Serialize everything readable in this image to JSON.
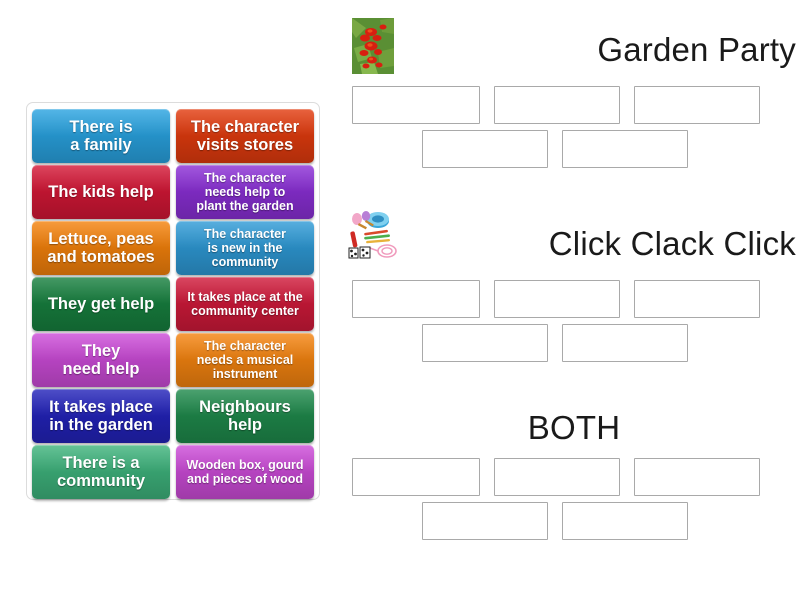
{
  "activity": {
    "type": "group-sort",
    "tile_panel": {
      "name": "draggable-items",
      "tiles": [
        {
          "text": "There is\na family",
          "color": "#29a3e0",
          "size": "big"
        },
        {
          "text": "The character\nvisits stores",
          "color": "#e23b0e",
          "size": "big"
        },
        {
          "text": "The kids help",
          "color": "#d41736",
          "size": "big"
        },
        {
          "text": "The character\nneeds help to\nplant the garden",
          "color": "#8b2fd6",
          "size": "small"
        },
        {
          "text": "Lettuce, peas\nand tomatoes",
          "color": "#f5820b",
          "size": "big"
        },
        {
          "text": "The character\nis new in the\ncommunity",
          "color": "#2e9ad6",
          "size": "small"
        },
        {
          "text": "They get help",
          "color": "#17803f",
          "size": "big"
        },
        {
          "text": "It takes place at the\ncommunity center",
          "color": "#d0193a",
          "size": "small"
        },
        {
          "text": "They\nneed help",
          "color": "#cc4bd8",
          "size": "big"
        },
        {
          "text": "The character\nneeds a musical\ninstrument",
          "color": "#f58410",
          "size": "small"
        },
        {
          "text": "It takes place\nin the garden",
          "color": "#2323ba",
          "size": "big"
        },
        {
          "text": "Neighbours\nhelp",
          "color": "#1f8a4c",
          "size": "big"
        },
        {
          "text": "There is a\ncommunity",
          "color": "#3eb37c",
          "size": "big"
        },
        {
          "text": "Wooden box, gourd\nand pieces of wood",
          "color": "#cc4bd8",
          "size": "small"
        }
      ]
    },
    "groups": [
      {
        "title": "Garden Party",
        "image": "garden-plant-photo",
        "has_image": true,
        "title_align": "right",
        "dropzones": [
          3,
          2
        ]
      },
      {
        "title": "Click Clack Click",
        "image": "musical-instruments-illustration",
        "has_image": true,
        "title_align": "right",
        "dropzones": [
          3,
          2
        ]
      },
      {
        "title": "BOTH",
        "image": null,
        "has_image": false,
        "title_align": "center",
        "dropzones": [
          3,
          2
        ]
      }
    ]
  },
  "colors": {
    "page_background": "#ffffff",
    "panel_border": "#dcdcdc",
    "dropzone_border": "#a9a9a9",
    "title_text": "#1a1a1a",
    "tile_text": "#ffffff"
  }
}
